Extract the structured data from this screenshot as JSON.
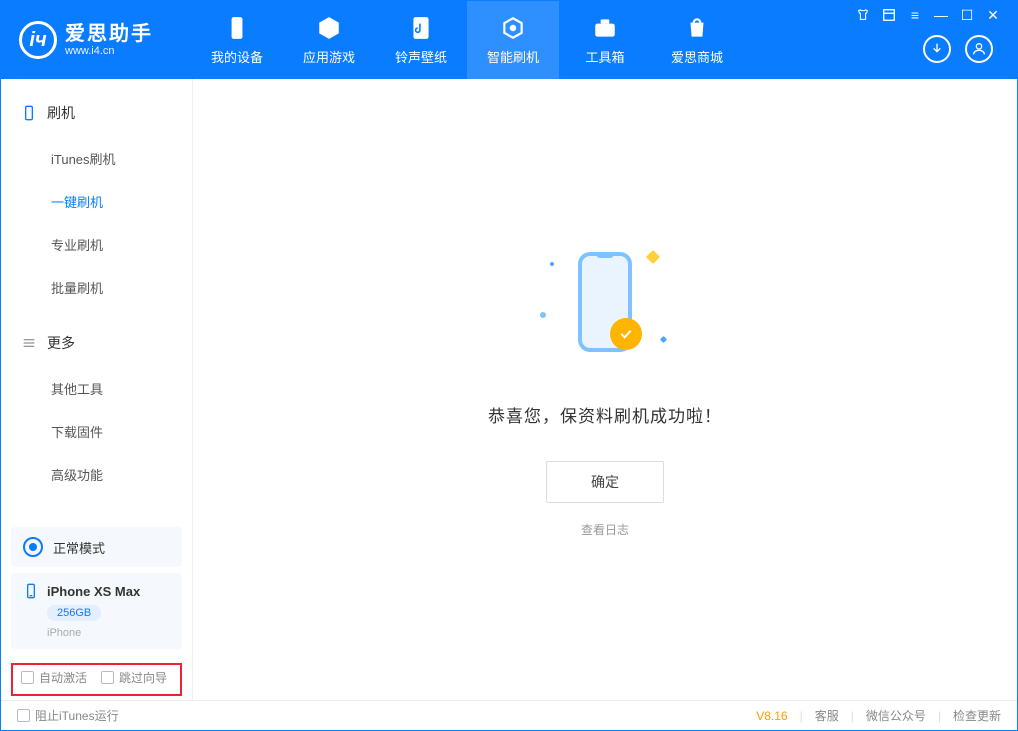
{
  "app": {
    "title": "爱思助手",
    "url": "www.i4.cn"
  },
  "nav": [
    {
      "label": "我的设备",
      "icon": "device"
    },
    {
      "label": "应用游戏",
      "icon": "cube"
    },
    {
      "label": "铃声壁纸",
      "icon": "music"
    },
    {
      "label": "智能刷机",
      "icon": "refresh",
      "active": true
    },
    {
      "label": "工具箱",
      "icon": "toolbox"
    },
    {
      "label": "爱思商城",
      "icon": "shop"
    }
  ],
  "sidebar": {
    "flash_head": "刷机",
    "flash_items": [
      "iTunes刷机",
      "一键刷机",
      "专业刷机",
      "批量刷机"
    ],
    "flash_active_index": 1,
    "more_head": "更多",
    "more_items": [
      "其他工具",
      "下载固件",
      "高级功能"
    ]
  },
  "mode": {
    "label": "正常模式"
  },
  "device": {
    "name": "iPhone XS Max",
    "storage": "256GB",
    "type": "iPhone"
  },
  "checks": {
    "auto_activate": "自动激活",
    "skip_guide": "跳过向导"
  },
  "main": {
    "success_msg": "恭喜您，保资料刷机成功啦！",
    "ok_btn": "确定",
    "log_link": "查看日志"
  },
  "footer": {
    "block_itunes": "阻止iTunes运行",
    "version": "V8.16",
    "service": "客服",
    "wechat": "微信公众号",
    "update": "检查更新"
  }
}
